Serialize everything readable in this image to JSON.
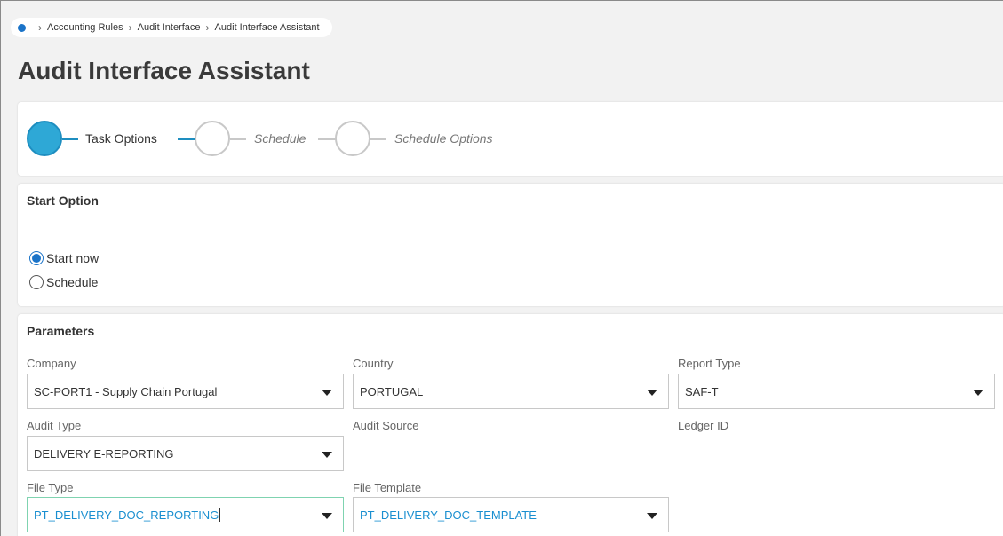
{
  "breadcrumb": {
    "items": [
      "Accounting Rules",
      "Audit Interface",
      "Audit Interface Assistant"
    ]
  },
  "page_title": "Audit Interface Assistant",
  "steps": [
    {
      "label": "Task Options",
      "state": "active"
    },
    {
      "label": "Schedule",
      "state": "pending"
    },
    {
      "label": "Schedule Options",
      "state": "pending"
    }
  ],
  "start_option": {
    "title": "Start Option",
    "options": [
      {
        "label": "Start now",
        "checked": true
      },
      {
        "label": "Schedule",
        "checked": false
      }
    ]
  },
  "parameters": {
    "title": "Parameters",
    "company": {
      "label": "Company",
      "value": "SC-PORT1 - Supply Chain Portugal"
    },
    "country": {
      "label": "Country",
      "value": "PORTUGAL"
    },
    "report_type": {
      "label": "Report Type",
      "value": "SAF-T"
    },
    "audit_type": {
      "label": "Audit Type",
      "value": "DELIVERY E-REPORTING"
    },
    "audit_source": {
      "label": "Audit Source"
    },
    "ledger_id": {
      "label": "Ledger ID"
    },
    "file_type": {
      "label": "File Type",
      "value": "PT_DELIVERY_DOC_REPORTING"
    },
    "file_template": {
      "label": "File Template",
      "value": "PT_DELIVERY_DOC_TEMPLATE"
    }
  },
  "colors": {
    "accent": "#1e8ec0",
    "step_active_fill": "#2ea8d6",
    "link": "#1a8fd0",
    "radio": "#1a73c8"
  }
}
